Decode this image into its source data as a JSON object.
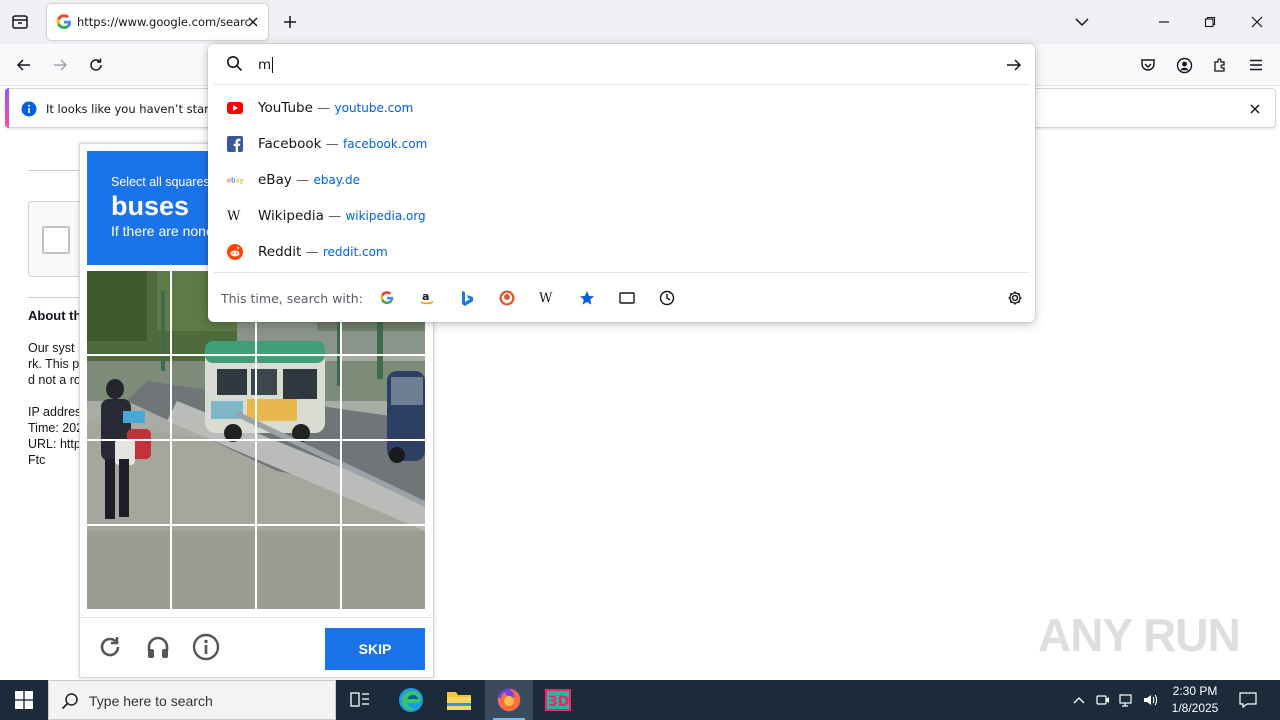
{
  "browser": {
    "tab": {
      "title": "https://www.google.com/search"
    },
    "infobar": {
      "message": "It looks like you haven’t started"
    }
  },
  "urlbar": {
    "input_value": "m",
    "suggestions": [
      {
        "name": "YouTube",
        "dash": "—",
        "url": "youtube.com",
        "icon": "youtube-icon"
      },
      {
        "name": "Facebook",
        "dash": "—",
        "url": "facebook.com",
        "icon": "facebook-icon"
      },
      {
        "name": "eBay",
        "dash": "—",
        "url": "ebay.de",
        "icon": "ebay-icon"
      },
      {
        "name": "Wikipedia",
        "dash": "—",
        "url": "wikipedia.org",
        "icon": "wikipedia-icon"
      },
      {
        "name": "Reddit",
        "dash": "—",
        "url": "reddit.com",
        "icon": "reddit-icon"
      }
    ],
    "oneoff_label": "This time, search with:",
    "engines": [
      "google-icon",
      "amazon-icon",
      "bing-icon",
      "duckduckgo-icon",
      "wikipedia-icon",
      "bookmarks-icon",
      "tabs-icon",
      "history-icon"
    ]
  },
  "page": {
    "about_heading": "About th",
    "lines": [
      "Our syst",
      "rk. This p",
      "d not a ro",
      "IP addres",
      "Time: 202",
      "URL: http",
      "Ftc"
    ]
  },
  "captcha": {
    "line1": "Select all squares",
    "line2": "buses",
    "line3": "If there are none",
    "skip_label": "SKIP"
  },
  "taskbar": {
    "search_placeholder": "Type here to search",
    "time": "2:30 PM",
    "date": "1/8/2025"
  },
  "watermark": "ANY RUN",
  "colors": {
    "accent_blue": "#1a73e8",
    "taskbar": "#1c2b3a",
    "link": "#0061e0"
  }
}
